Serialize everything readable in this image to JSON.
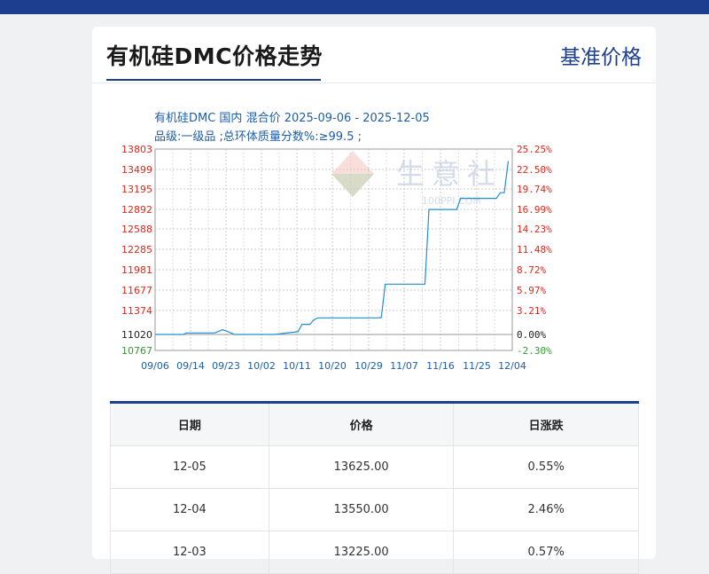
{
  "header": {
    "title": "有机硅DMC价格走势",
    "right_link": "基准价格"
  },
  "chart_data": {
    "type": "line",
    "title": "有机硅DMC 国内 混合价 2025-09-06 - 2025-12-05",
    "subtitle": "品级:一级品 ;总环体质量分数%:≥99.5 ;",
    "watermark": "生意社",
    "watermark_sub": "100PPI.COM",
    "x_ticks": [
      "09/06",
      "09/14",
      "09/23",
      "10/02",
      "10/11",
      "10/20",
      "10/29",
      "11/07",
      "11/16",
      "11/25",
      "12/04"
    ],
    "y_left_ticks": [
      "13803",
      "13499",
      "13195",
      "12892",
      "12588",
      "12285",
      "11981",
      "11677",
      "11374",
      "11020",
      "10767"
    ],
    "y_right_ticks": [
      "25.25%",
      "22.50%",
      "19.74%",
      "16.99%",
      "14.23%",
      "11.48%",
      "8.72%",
      "5.97%",
      "3.21%",
      "0.00%",
      "-2.30%"
    ],
    "ylim": [
      10767,
      13803
    ],
    "xlim": [
      0,
      90
    ],
    "series": [
      {
        "x": [
          0,
          7,
          8,
          9,
          10,
          11,
          15,
          17,
          18,
          20,
          30,
          36,
          37,
          39,
          40,
          41,
          56,
          57,
          58,
          68,
          69,
          76,
          77,
          78,
          86,
          87,
          88,
          89
        ],
        "y": [
          11020,
          11020,
          11042,
          11042,
          11042,
          11042,
          11042,
          11090,
          11070,
          11020,
          11020,
          11060,
          11170,
          11170,
          11235,
          11265,
          11265,
          11270,
          11765,
          11765,
          12890,
          12890,
          13055,
          13055,
          13055,
          13140,
          13140,
          13625
        ],
        "color": "#1f8fd6"
      }
    ],
    "colors": {
      "left_axis": "#e0281a",
      "right_axis": "#e0281a",
      "negative": "#2e9e2e",
      "x_axis": "#1d5fa8"
    }
  },
  "table": {
    "headers": [
      "日期",
      "价格",
      "日涨跌"
    ],
    "rows": [
      [
        "12-05",
        "13625.00",
        "0.55%"
      ],
      [
        "12-04",
        "13550.00",
        "2.46%"
      ],
      [
        "12-03",
        "13225.00",
        "0.57%"
      ]
    ]
  }
}
